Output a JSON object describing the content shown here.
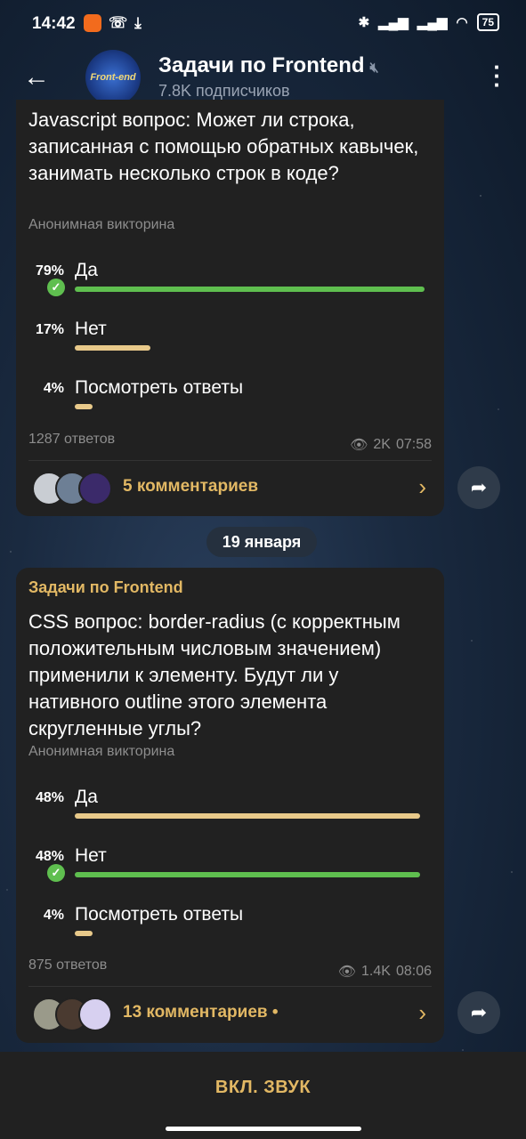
{
  "status_bar": {
    "time": "14:42",
    "battery": "75",
    "icons": [
      "app-badge-icon",
      "viber-icon",
      "download-icon",
      "bluetooth-icon",
      "signal-icon",
      "signal-icon",
      "wifi-icon",
      "battery-icon"
    ]
  },
  "header": {
    "channel_name": "Задачи по Frontend",
    "subscribers": "7.8K подписчиков",
    "avatar_text": "Front-end",
    "muted": true
  },
  "posts": [
    {
      "question": "Javascript вопрос: Может ли строка, записанная с помощью обратных кавычек, занимать несколько строк в коде?",
      "quiz_type": "Анонимная викторина",
      "options": [
        {
          "percent": "79%",
          "label": "Да",
          "fraction": 0.79,
          "correct": true
        },
        {
          "percent": "17%",
          "label": "Нет",
          "fraction": 0.17,
          "correct": false
        },
        {
          "percent": "4%",
          "label": "Посмотреть ответы",
          "fraction": 0.04,
          "correct": false
        }
      ],
      "answers": "1287 ответов",
      "views": "2K",
      "time": "07:58",
      "comments": "5 комментариев"
    },
    {
      "author": "Задачи по Frontend",
      "question": "CSS вопрос: border-radius (с корректным положительным числовым значением) применили к элементу. Будут ли у нативного outline этого элемента скругленные углы?",
      "quiz_type": "Анонимная викторина",
      "options": [
        {
          "percent": "48%",
          "label": "Да",
          "fraction": 0.48,
          "correct": false
        },
        {
          "percent": "48%",
          "label": "Нет",
          "fraction": 0.48,
          "correct": true
        },
        {
          "percent": "4%",
          "label": "Посмотреть ответы",
          "fraction": 0.04,
          "correct": false
        }
      ],
      "answers": "875 ответов",
      "views": "1.4K",
      "time": "08:06",
      "comments": "13 комментариев •"
    }
  ],
  "date_separator": "19 января",
  "bottom_button": "ВКЛ. ЗВУК",
  "colors": {
    "accent": "#e2b864",
    "correct": "#5fbf4f",
    "bar_neutral": "#e8c98a",
    "bubble": "#212121"
  }
}
